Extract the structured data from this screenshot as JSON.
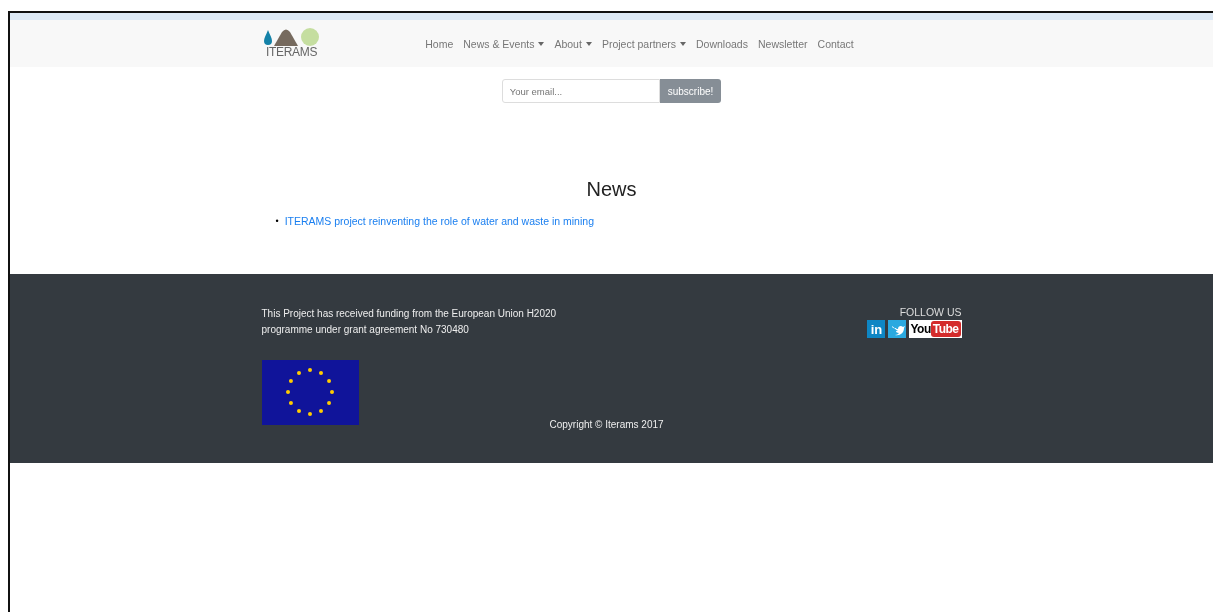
{
  "logo": {
    "text": "ITERAMS"
  },
  "nav": [
    {
      "label": "Home",
      "dropdown": false
    },
    {
      "label": "News & Events",
      "dropdown": true
    },
    {
      "label": "About",
      "dropdown": true
    },
    {
      "label": "Project partners",
      "dropdown": true
    },
    {
      "label": "Downloads",
      "dropdown": false
    },
    {
      "label": "Newsletter",
      "dropdown": false
    },
    {
      "label": "Contact",
      "dropdown": false
    }
  ],
  "subscribe": {
    "placeholder": "Your email...",
    "button": "subscribe!"
  },
  "news": {
    "title": "News",
    "items": [
      {
        "bullet": "•",
        "text": "ITERAMS project reinventing the role of water and waste in mining"
      }
    ]
  },
  "footer": {
    "funding": "This Project has received funding from the European Union H2020 programme under grant agreement No 730480",
    "follow": "FOLLOW US",
    "social": [
      {
        "kind": "linkedin",
        "label": "in"
      },
      {
        "kind": "twitter"
      },
      {
        "kind": "youtube",
        "label": "You",
        "label2": "Tube"
      }
    ],
    "copyright": "Copyright © Iterams 2017"
  }
}
